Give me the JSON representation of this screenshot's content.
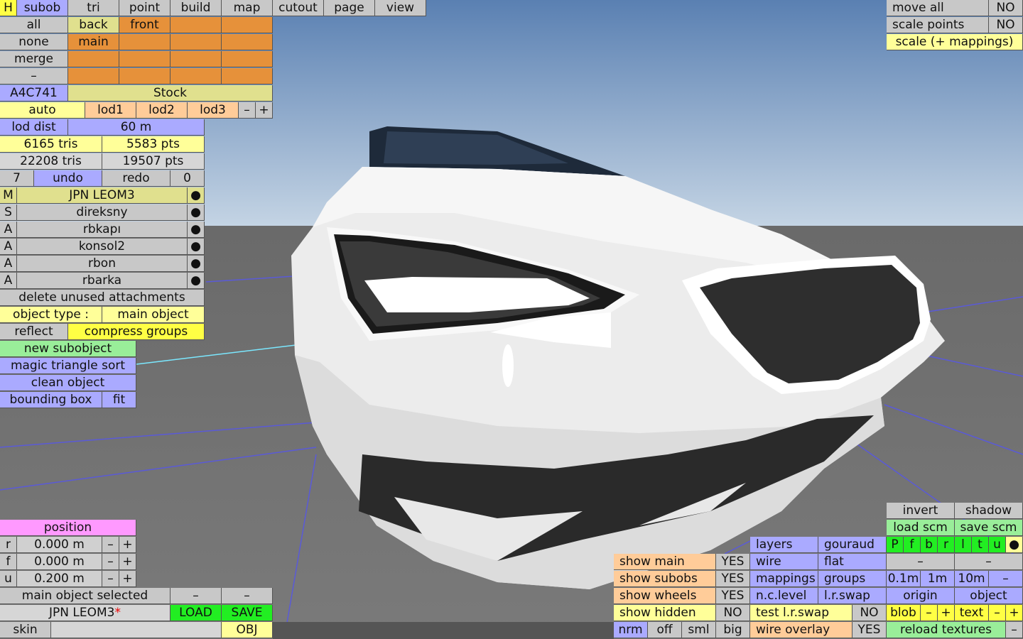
{
  "top_menu": {
    "h": "H",
    "items": [
      "subob",
      "tri",
      "point",
      "build",
      "map",
      "cutout",
      "page",
      "view"
    ]
  },
  "left_panel": {
    "sel_all": "all",
    "sel_none": "none",
    "sel_merge": "merge",
    "sel_dash": "–",
    "back": "back",
    "front": "front",
    "main": "main",
    "color_code": "A4C741",
    "skin_name": "Stock",
    "auto": "auto",
    "lod1": "lod1",
    "lod2": "lod2",
    "lod3": "lod3",
    "minus": "–",
    "plus": "+",
    "lod_dist_label": "lod dist",
    "lod_dist_value": "60 m",
    "tris1": "6165 tris",
    "pts1": "5583 pts",
    "tris2": "22208 tris",
    "pts2": "19507 pts",
    "undo_count": "7",
    "undo": "undo",
    "redo": "redo",
    "redo_count": "0",
    "objects": [
      {
        "type": "M",
        "name": "JPN LEOM3",
        "dot": "●"
      },
      {
        "type": "S",
        "name": "direksny",
        "dot": "●"
      },
      {
        "type": "A",
        "name": "rbkapı",
        "dot": "●"
      },
      {
        "type": "A",
        "name": "konsol2",
        "dot": "●"
      },
      {
        "type": "A",
        "name": "rbon",
        "dot": "●"
      },
      {
        "type": "A",
        "name": "rbarka",
        "dot": "●"
      }
    ],
    "delete_unused": "delete unused attachments",
    "object_type_label": "object type :",
    "object_type_value": "main object",
    "reflect": "reflect",
    "compress_groups": "compress groups",
    "new_subobject": "new subobject",
    "magic_sort": "magic triangle sort",
    "clean_object": "clean object",
    "bounding_box": "bounding box",
    "fit": "fit"
  },
  "position_panel": {
    "title": "position",
    "rows": [
      {
        "axis": "r",
        "value": "0.000 m",
        "minus": "–",
        "plus": "+"
      },
      {
        "axis": "f",
        "value": "0.000 m",
        "minus": "–",
        "plus": "+"
      },
      {
        "axis": "u",
        "value": "0.200 m",
        "minus": "–",
        "plus": "+"
      }
    ],
    "status": "main object selected",
    "dash1": "–",
    "dash2": "–",
    "file_name": "JPN LEOM3",
    "modified_mark": "*",
    "load": "LOAD",
    "save": "SAVE",
    "skin": "skin",
    "skin_value": "",
    "obj": "OBJ"
  },
  "top_right": {
    "move_all": "move all",
    "move_all_val": "NO",
    "scale_points": "scale points",
    "scale_points_val": "NO",
    "scale_mappings": "scale (+ mappings)"
  },
  "bottom_right": {
    "invert": "invert",
    "shadow": "shadow",
    "load_scm": "load scm",
    "save_scm": "save scm",
    "views": [
      "P",
      "f",
      "b",
      "r",
      "l",
      "t",
      "u"
    ],
    "views_dot": "●",
    "dash_a": "–",
    "dash_b": "–",
    "grid_01": "0.1m",
    "grid_1": "1m",
    "grid_10": "10m",
    "grid_minus": "–",
    "origin": "origin",
    "object": "object",
    "blob": "blob",
    "blob_minus": "–",
    "blob_plus": "+",
    "text": "text",
    "text_minus": "–",
    "text_plus": "+",
    "reload_textures": "reload textures",
    "reload_minus": "–"
  },
  "view_options": {
    "show_main": "show main",
    "show_main_val": "YES",
    "show_subobs": "show subobs",
    "show_subobs_val": "YES",
    "show_wheels": "show wheels",
    "show_wheels_val": "YES",
    "show_hidden": "show hidden",
    "show_hidden_val": "NO",
    "nrm": "nrm",
    "off": "off",
    "sml": "sml",
    "big": "big",
    "layers": "layers",
    "gouraud": "gouraud",
    "wire": "wire",
    "flat": "flat",
    "mappings": "mappings",
    "groups": "groups",
    "nc_level": "n.c.level",
    "lr_swap": "l.r.swap",
    "test_lr_swap": "test l.r.swap",
    "test_lr_swap_val": "NO",
    "wire_overlay": "wire overlay",
    "wire_overlay_val": "YES"
  },
  "colors": {
    "sky_top": "#5b82b3",
    "sky_bottom": "#c2d3e4",
    "ground": "#707070",
    "car_body": "#ececec"
  }
}
